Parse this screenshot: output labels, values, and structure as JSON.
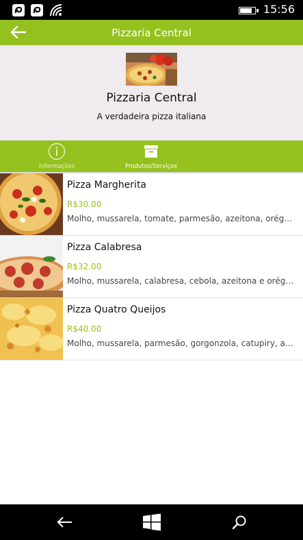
{
  "status_bar": {
    "time": "15:56",
    "battery_level": 0.85,
    "icons": [
      "notification-icon",
      "notification-icon",
      "wifi-icon",
      "battery-icon"
    ]
  },
  "header": {
    "title": "Pizzaria Central",
    "back_icon": "back-arrow-icon"
  },
  "colors": {
    "accent": "#95c11f",
    "hero_background": "#efebef",
    "price": "#95c11f"
  },
  "business": {
    "name": "Pizzaria Central",
    "tagline": "A verdadeira pizza italiana"
  },
  "tabs": [
    {
      "label": "Informações",
      "icon": "info-icon",
      "active": false
    },
    {
      "label": "Produtos/Serviços",
      "icon": "archive-box-icon",
      "active": true
    }
  ],
  "products": [
    {
      "name": "Pizza Margherita",
      "price": "R$30.00",
      "description": "Molho, mussarela, tomate, parmesão, azeitona, orégano..."
    },
    {
      "name": "Pizza Calabresa",
      "price": "R$32.00",
      "description": "Molho, mussarela, calabresa, cebola, azeitona e orégano."
    },
    {
      "name": "Pizza Quatro Queijos",
      "price": "R$40.00",
      "description": "Molho, mussarela, parmesão, gorgonzola, catupiry, azeit..."
    }
  ],
  "nav_bar": {
    "icons": [
      "back-icon",
      "windows-start-icon",
      "search-icon"
    ]
  }
}
